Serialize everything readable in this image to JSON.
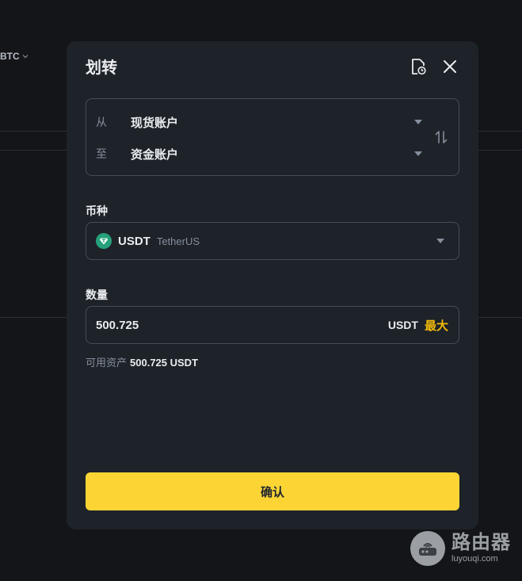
{
  "background": {
    "asset_selector": "BTC"
  },
  "modal": {
    "title": "划转",
    "from": {
      "label": "从",
      "account": "现货账户"
    },
    "to": {
      "label": "至",
      "account": "资金账户"
    },
    "coin": {
      "label": "币种",
      "symbol": "USDT",
      "name": "TetherUS",
      "icon_color": "#26a17b"
    },
    "amount": {
      "label": "数量",
      "value": "500.725",
      "unit": "USDT",
      "max_label": "最大"
    },
    "available": {
      "label": "可用资产",
      "value": "500.725 USDT"
    },
    "confirm_label": "确认"
  },
  "colors": {
    "page_bg": "#131518",
    "modal_bg": "#1e2329",
    "accent": "#fcd535",
    "max_text": "#f0b90b"
  },
  "icons": {
    "history": "history-icon",
    "close": "close-icon",
    "swap": "swap-icon",
    "coin": "usdt-icon"
  },
  "watermark": {
    "cn": "路由器",
    "en": "luyouqi.com"
  }
}
